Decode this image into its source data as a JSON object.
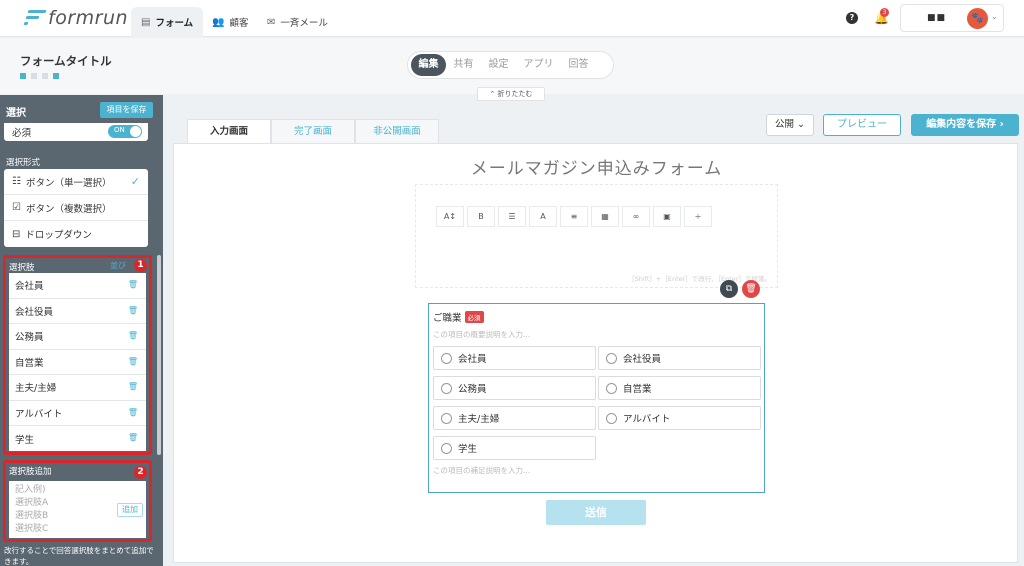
{
  "app": {
    "logo_text": "formrun"
  },
  "nav": {
    "tabs": [
      {
        "label": "フォーム",
        "icon": "form-icon"
      },
      {
        "label": "顧客",
        "icon": "users-icon"
      },
      {
        "label": "一斉メール",
        "icon": "mail-icon"
      }
    ],
    "notification_count": "3",
    "account_name": "■■",
    "help_glyph": "?"
  },
  "header": {
    "form_title": "フォームタイトル",
    "steps": [
      "編集",
      "共有",
      "設定",
      "アプリ",
      "回答"
    ],
    "collapse_label": "折りたたむ"
  },
  "sidebar": {
    "title": "選択",
    "save_item_label": "項目を保存",
    "required_label": "必須",
    "toggle_label": "ON",
    "type_section_label": "選択形式",
    "types": [
      {
        "label": "ボタン（単一選択）",
        "icon": "radio-list-icon",
        "selected": true
      },
      {
        "label": "ボタン（複数選択）",
        "icon": "checkbox-icon",
        "selected": false
      },
      {
        "label": "ドロップダウン",
        "icon": "dropdown-icon",
        "selected": false
      }
    ],
    "choices_label": "選択肢",
    "sort_label": "並び",
    "badge1": "1",
    "choices": [
      "会社員",
      "会社役員",
      "公務員",
      "自営業",
      "主夫/主婦",
      "アルバイト",
      "学生"
    ],
    "add_label": "選択肢追加",
    "add_placeholder": "記入例)\n選択肢A\n選択肢B\n選択肢C",
    "add_button": "追加",
    "badge2": "2",
    "add_hint": "改行することで回答選択肢をまとめて追加できます。"
  },
  "editor": {
    "tabs": [
      "入力画面",
      "完了画面",
      "非公開画面"
    ],
    "public_select": "公開",
    "preview_label": "プレビュー",
    "save_label": "編集内容を保存",
    "form_heading": "メールマガジン申込みフォーム",
    "rte_buttons": [
      "A↕",
      "B",
      "☰",
      "A",
      "≡",
      "▦",
      "∞",
      "▣",
      "÷"
    ],
    "rte_hint": "［Shift］+［Enter］で改行、［Enter］で段落。",
    "question": {
      "title": "ご職業",
      "required_badge": "必須",
      "description_placeholder": "この項目の概要説明を入力...",
      "options": [
        "会社員",
        "会社役員",
        "公務員",
        "自営業",
        "主夫/主婦",
        "アルバイト",
        "学生"
      ],
      "footer_placeholder": "この項目の補足説明を入力..."
    },
    "submit_label": "送信"
  },
  "colors": {
    "accent": "#4bb3d0",
    "sidebar": "#5a6670",
    "danger": "#d9262a"
  }
}
